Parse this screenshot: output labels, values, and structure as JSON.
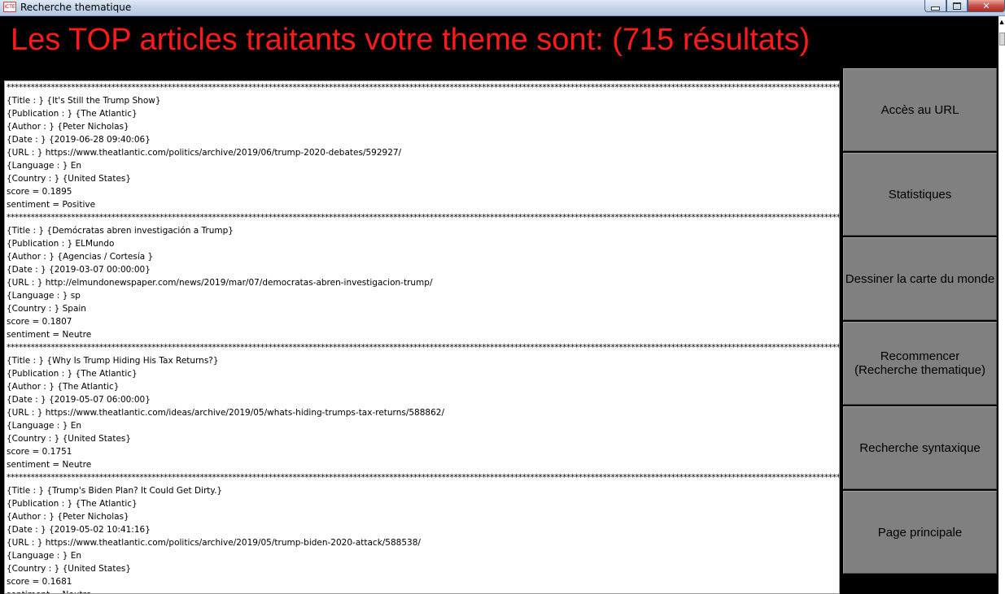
{
  "window": {
    "title": "Recherche thematique",
    "icon_text": "ICTE",
    "minimize_icon": "minimize-icon",
    "maximize_icon": "maximize-icon",
    "close_label": "✕"
  },
  "heading": "Les TOP articles traitants votre theme sont: (715 résultats)",
  "separator": "****************************************************************************************************************************************************************************************************************************************************",
  "articles": [
    {
      "title": "{Title : } {It's Still the Trump Show}",
      "publication": "{Publication : } {The Atlantic}",
      "author": "{Author : } {Peter Nicholas}",
      "date": "{Date : } {2019-06-28 09:40:06}",
      "url": "{URL : } https://www.theatlantic.com/politics/archive/2019/06/trump-2020-debates/592927/",
      "language": "{Language : } En",
      "country": "{Country : } {United States}",
      "score": "score = 0.1895",
      "sentiment": "sentiment = Positive"
    },
    {
      "title": "{Title : } {Demócratas abren investigación a Trump}",
      "publication": "{Publication : } ELMundo",
      "author": "{Author : } {Agencias / Cortesía }",
      "date": "{Date : } {2019-03-07 00:00:00}",
      "url": "{URL : } http://elmundonewspaper.com/news/2019/mar/07/democratas-abren-investigacion-trump/",
      "language": "{Language : } sp",
      "country": "{Country : } Spain",
      "score": "score = 0.1807",
      "sentiment": "sentiment = Neutre"
    },
    {
      "title": "{Title : } {Why Is Trump Hiding His Tax Returns?}",
      "publication": "{Publication : } {The Atlantic}",
      "author": "{Author : } {The Atlantic}",
      "date": "{Date : } {2019-05-07 06:00:00}",
      "url": "{URL : } https://www.theatlantic.com/ideas/archive/2019/05/whats-hiding-trumps-tax-returns/588862/",
      "language": "{Language : } En",
      "country": "{Country : } {United States}",
      "score": "score = 0.1751",
      "sentiment": "sentiment = Neutre"
    },
    {
      "title": "{Title : } {Trump's Biden Plan? It Could Get Dirty.}",
      "publication": "{Publication : } {The Atlantic}",
      "author": "{Author : } {Peter Nicholas}",
      "date": "{Date : } {2019-05-02 10:41:16}",
      "url": "{URL : } https://www.theatlantic.com/politics/archive/2019/05/trump-biden-2020-attack/588538/",
      "language": "{Language : } En",
      "country": "{Country : } {United States}",
      "score": "score = 0.1681",
      "sentiment": "sentiment = Neutre"
    }
  ],
  "side_buttons": [
    {
      "label": "Accès au URL"
    },
    {
      "label": "Statistiques"
    },
    {
      "label": "Dessiner la carte du monde"
    },
    {
      "label": "Recommencer\n(Recherche thematique)"
    },
    {
      "label": "Recherche syntaxique"
    },
    {
      "label": "Page principale"
    }
  ],
  "scrollbar": {
    "up_arrow": "▲"
  }
}
